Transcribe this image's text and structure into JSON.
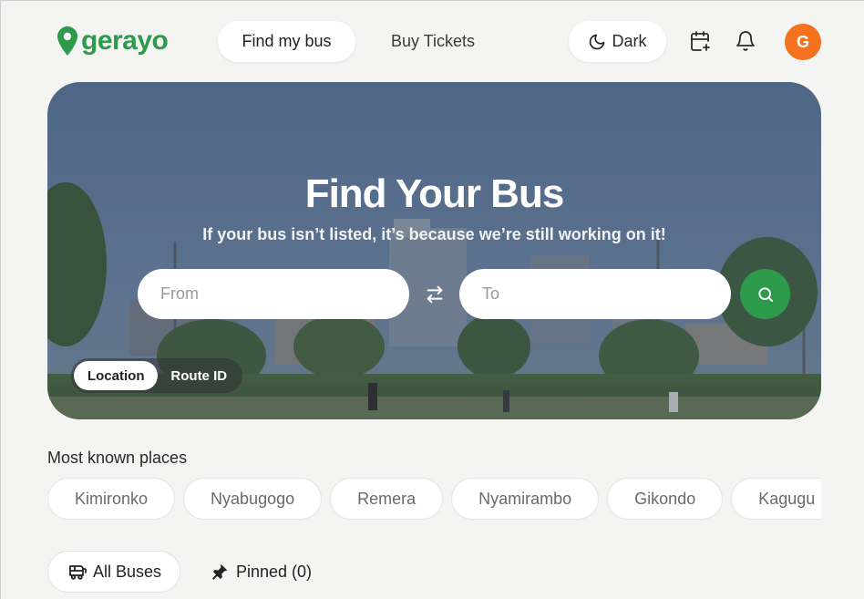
{
  "brand": {
    "name": "gerayo",
    "color": "#2e9a4c"
  },
  "nav": {
    "find_label": "Find my bus",
    "buy_label": "Buy Tickets"
  },
  "header": {
    "dark_label": "Dark",
    "avatar_initial": "G",
    "avatar_color": "#f4711e"
  },
  "hero": {
    "title": "Find Your Bus",
    "subtitle": "If your bus isn’t listed, it’s because we’re still working on it!",
    "from_placeholder": "From",
    "to_placeholder": "To",
    "mode_location": "Location",
    "mode_route": "Route ID"
  },
  "places": {
    "title": "Most known places",
    "items": [
      "Kimironko",
      "Nyabugogo",
      "Remera",
      "Nyamirambo",
      "Gikondo",
      "Kagugu"
    ]
  },
  "tabs": {
    "all_label": "All Buses",
    "pinned_label": "Pinned (0)"
  },
  "icons": {
    "logo": "map-pin-icon",
    "dark": "moon-icon",
    "calendar": "calendar-plus-icon",
    "bell": "bell-icon",
    "swap": "swap-arrows-icon",
    "search": "search-icon",
    "bus": "bus-icon",
    "pin": "pushpin-icon"
  }
}
